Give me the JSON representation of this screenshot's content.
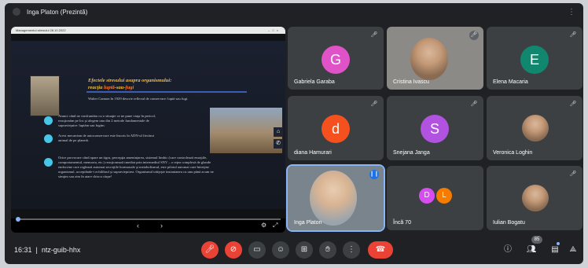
{
  "presenter_bar": {
    "name": "Inga Platon (Prezintă)"
  },
  "presentation": {
    "window_title": "Managementul stresului 28.10.2022",
    "slide": {
      "title_line1": "Efectele stresului asupra organismului:",
      "title_line2_a": "reacţia",
      "title_line2_b": "luptă",
      "title_line2_c": "sau",
      "title_line2_d": "fugi",
      "intro": "Walter Cannon în 1929 descrie reflexul de conservare: luptă sau fugi.",
      "bullet1_l1": "Atunci când ne confruntăm cu o situaţie ce ne pune viaţa în pericol,",
      "bullet1_l2": "reacţionăm pe loc şi alegem una din 2 metode fundamentale de",
      "bullet1_l3": "supravieţuire: luptăm sau fugim.",
      "bullet2_l1": "Acest mecanism de autoconservare este înscris în ADN-ul fiecărui",
      "bullet2_l2": "animal de pe planetă.",
      "bullet3_l1": "Orice provocare când apare un tigru, percepţia amenințarea, sistemul limbic (care controlează emoţiile,",
      "bullet3_l2": "comportamentul, memoria, etc.) reacţionează imediat prin intermediul SNV – o reţea complexă de glande",
      "bullet3_l3": "endocrine care reglează automat secreţiile hormonale şi metabolismul, este pilotul automat care întreţine",
      "bullet3_l4": "organismul, acceptânde-i echilibrul şi supravieţuirea. Organismul trăiţeşte instantaneu cu unu până acum ne",
      "bullet3_l5": "simţim sau zim în atare chiscu cărpe!"
    }
  },
  "participants": [
    {
      "name": "Gabriela Garaba",
      "initial": "G",
      "color": "#e052c8"
    },
    {
      "name": "Cristina Ivascu",
      "initial": ""
    },
    {
      "name": "Elena Macaria",
      "initial": "E",
      "color": "#12876f"
    },
    {
      "name": "diana Hamurari",
      "initial": "d",
      "color": "#f4511e"
    },
    {
      "name": "Snejana Janga",
      "initial": "S",
      "color": "#b152e0"
    },
    {
      "name": "Veronica Loghin",
      "initial": ""
    },
    {
      "name": "Inga Platon",
      "initial": ""
    },
    {
      "name": "Încă 70",
      "avatar1": "D",
      "avatar1_color": "#d64ef0",
      "avatar2": "L",
      "avatar2_color": "#f57c00"
    },
    {
      "name": "Iulian Bogatu",
      "initial": ""
    }
  ],
  "meeting": {
    "time": "16:31",
    "code": "ntz-guib-hhx",
    "participant_count": "85"
  },
  "icons": {
    "mic_off": "mic-off-icon",
    "cam_off": "camera-off-icon",
    "captions": "captions-icon",
    "emoji": "emoji-icon",
    "present": "present-icon",
    "hand": "raise-hand-icon",
    "more": "more-icon",
    "end": "end-call-icon",
    "info": "info-icon",
    "people": "people-icon",
    "chat": "chat-icon",
    "activities": "activities-icon"
  }
}
